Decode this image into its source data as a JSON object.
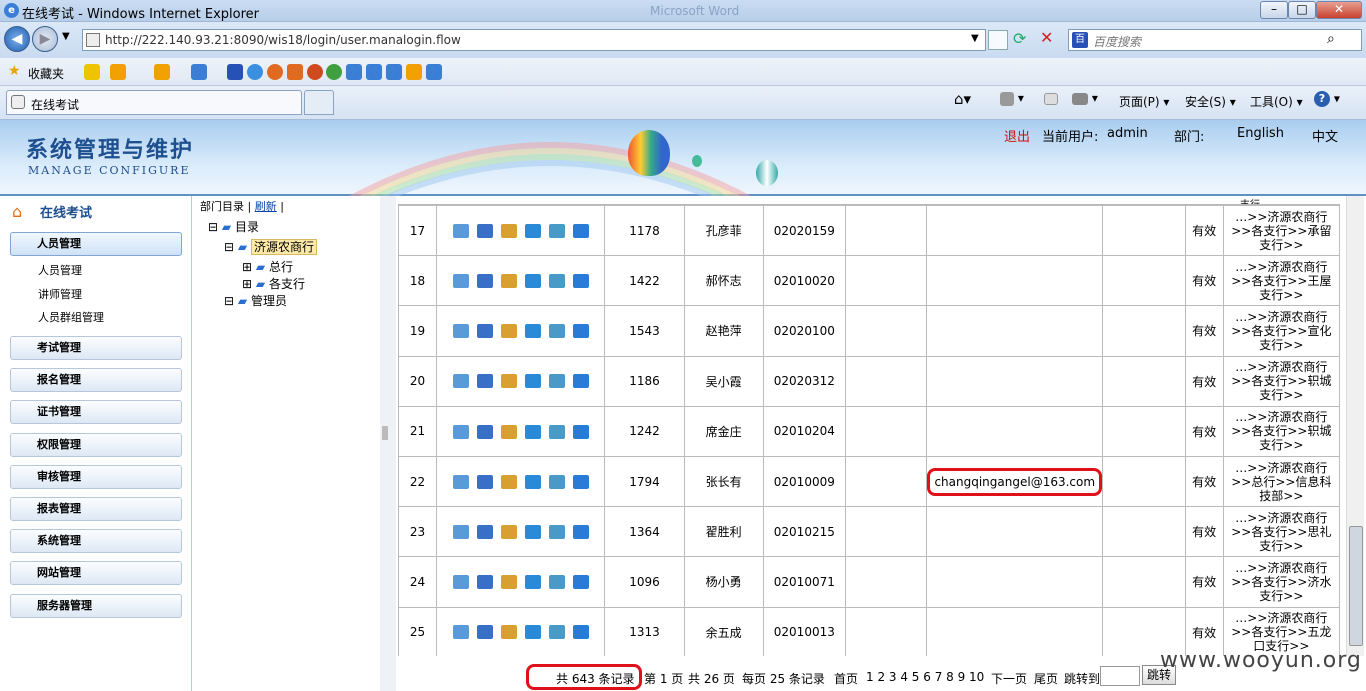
{
  "window": {
    "title": "在线考试 - Windows Internet Explorer",
    "background_title": "Microsoft Word"
  },
  "browser": {
    "url": "http://222.140.93.21:8090/wis18/login/user.manalogin.flow",
    "search_placeholder": "百度搜索",
    "favorites_label": "收藏夹",
    "tab_title": "在线考试",
    "commands": {
      "page": "页面(P)",
      "safety": "安全(S)",
      "tools": "工具(O)"
    }
  },
  "header": {
    "title": "系统管理与维护",
    "subtitle": "MANAGE CONFIGURE",
    "logout": "退出",
    "current_user_label": "当前用户:",
    "current_user": "admin",
    "dept_label": "部门:",
    "lang_en": "English",
    "lang_zh": "中文"
  },
  "sidebar": {
    "title": "在线考试",
    "active_group": "人员管理",
    "sub_items": [
      "人员管理",
      "讲师管理",
      "人员群组管理"
    ],
    "groups": [
      "考试管理",
      "报名管理",
      "证书管理",
      "权限管理",
      "审核管理",
      "报表管理",
      "系统管理",
      "网站管理",
      "服务器管理"
    ]
  },
  "tree": {
    "dir_label": "部门目录",
    "refresh": "刷新",
    "root": "目录",
    "bank": "济源农商行",
    "branch1": "总行",
    "branch2": "各支行",
    "admin": "管理员"
  },
  "rows": [
    {
      "no": "17",
      "id": "1178",
      "name": "孔彦菲",
      "code": "02020159",
      "email": "",
      "status": "有效",
      "dept": [
        "…>>济源农商行",
        ">>各支行>>承留",
        "支行>>"
      ]
    },
    {
      "no": "18",
      "id": "1422",
      "name": "郝怀志",
      "code": "02010020",
      "email": "",
      "status": "有效",
      "dept": [
        "…>>济源农商行",
        ">>各支行>>王屋",
        "支行>>"
      ]
    },
    {
      "no": "19",
      "id": "1543",
      "name": "赵艳萍",
      "code": "02020100",
      "email": "",
      "status": "有效",
      "dept": [
        "…>>济源农商行",
        ">>各支行>>宣化",
        "支行>>"
      ]
    },
    {
      "no": "20",
      "id": "1186",
      "name": "吴小霞",
      "code": "02020312",
      "email": "",
      "status": "有效",
      "dept": [
        "…>>济源农商行",
        ">>各支行>>轵城",
        "支行>>"
      ]
    },
    {
      "no": "21",
      "id": "1242",
      "name": "席金庄",
      "code": "02010204",
      "email": "",
      "status": "有效",
      "dept": [
        "…>>济源农商行",
        ">>各支行>>轵城",
        "支行>>"
      ]
    },
    {
      "no": "22",
      "id": "1794",
      "name": "张长有",
      "code": "02010009",
      "email": "changqingangel@163.com",
      "status": "有效",
      "dept": [
        "…>>济源农商行",
        ">>总行>>信息科",
        "技部>>"
      ]
    },
    {
      "no": "23",
      "id": "1364",
      "name": "翟胜利",
      "code": "02010215",
      "email": "",
      "status": "有效",
      "dept": [
        "…>>济源农商行",
        ">>各支行>>思礼",
        "支行>>"
      ]
    },
    {
      "no": "24",
      "id": "1096",
      "name": "杨小勇",
      "code": "02010071",
      "email": "",
      "status": "有效",
      "dept": [
        "…>>济源农商行",
        ">>各支行>>济水",
        "支行>>"
      ]
    },
    {
      "no": "25",
      "id": "1313",
      "name": "余五成",
      "code": "02010013",
      "email": "",
      "status": "有效",
      "dept": [
        "…>>济源农商行",
        ">>各支行>>五龙",
        "口支行>>"
      ]
    }
  ],
  "pager": {
    "total": "共 643 条记录",
    "page": "第 1 页",
    "pages": "共 26 页",
    "per": "每页 25 条记录",
    "first": "首页",
    "nums": "1 2 3 4 5 6 7 8 9 10",
    "next": "下一页",
    "last": "尾页",
    "goto": "跳转到",
    "jump": "跳转"
  },
  "watermark": "www.wooyun.org",
  "colors": {
    "accent": "#1e4f8f",
    "highlight": "#e0101a",
    "logout": "#d01010"
  }
}
